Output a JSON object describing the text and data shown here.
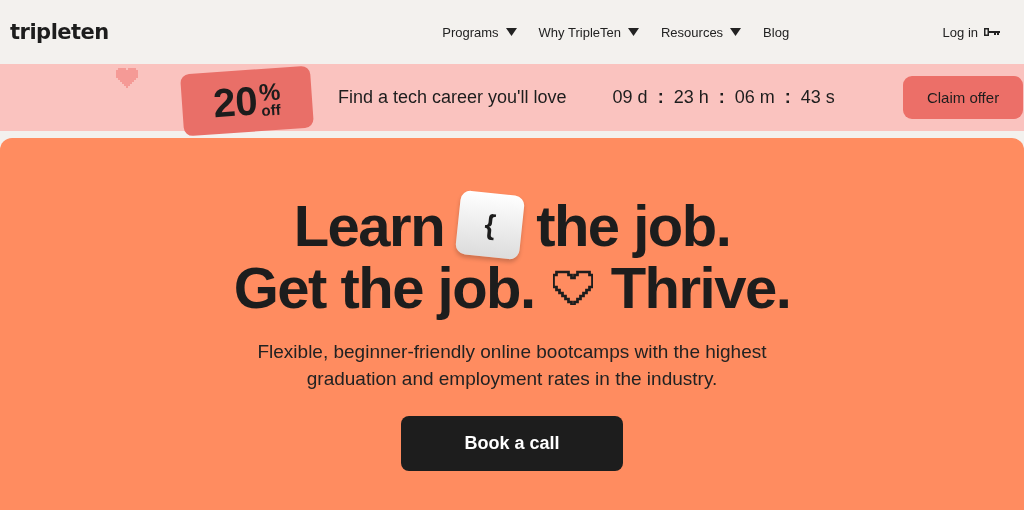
{
  "header": {
    "logo": "tripleten",
    "nav": [
      {
        "label": "Programs",
        "dropdown": true
      },
      {
        "label": "Why TripleTen",
        "dropdown": true
      },
      {
        "label": "Resources",
        "dropdown": true
      },
      {
        "label": "Blog",
        "dropdown": false
      }
    ],
    "login": "Log in"
  },
  "promo": {
    "badge_number": "20",
    "badge_percent": "%",
    "badge_off": "off",
    "message": "Find a tech career you'll love",
    "countdown": [
      {
        "value": "09",
        "unit": "d"
      },
      {
        "value": "23",
        "unit": "h"
      },
      {
        "value": "06",
        "unit": "m"
      },
      {
        "value": "43",
        "unit": "s"
      }
    ],
    "separator": ":",
    "button": "Claim offer"
  },
  "hero": {
    "line1_start": "Learn",
    "key_label": "{",
    "line1_end": "the job.",
    "line2_start": "Get the job.",
    "line2_end": "Thrive.",
    "subtitle": "Flexible, beginner-friendly online bootcamps with the highest graduation and employment rates in the industry.",
    "button": "Book a call"
  }
}
